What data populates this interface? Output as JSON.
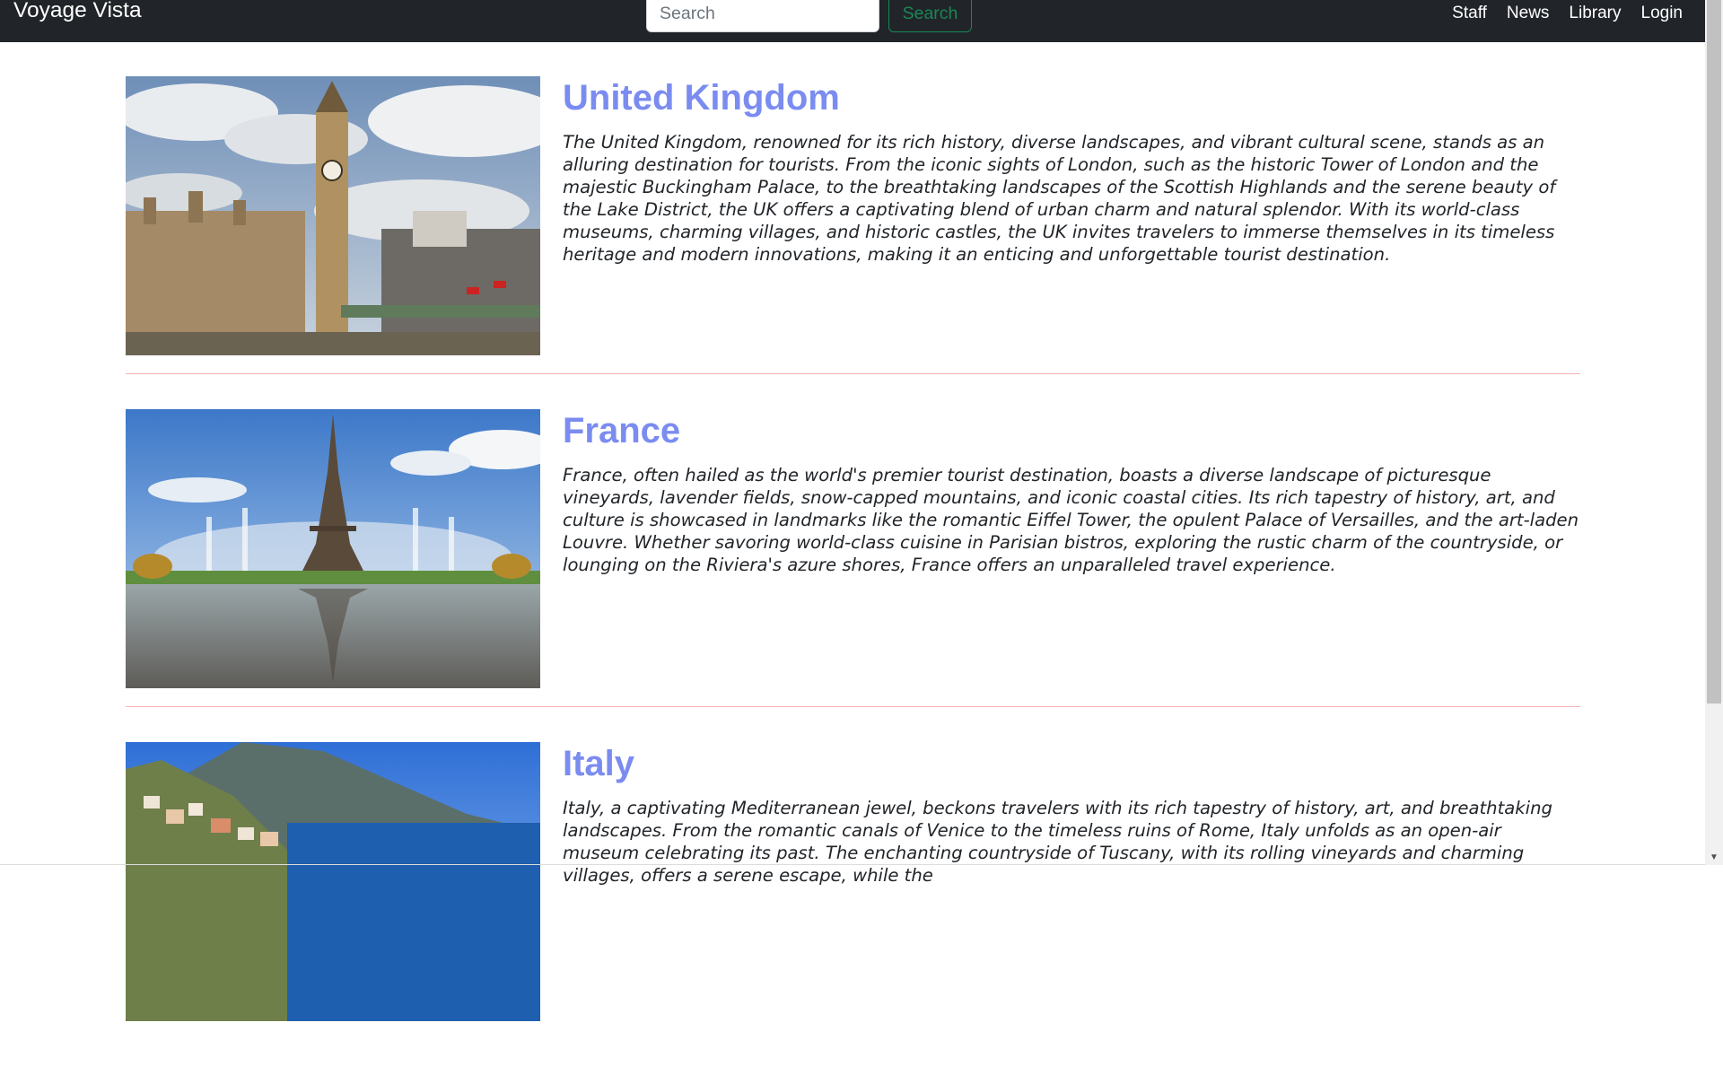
{
  "navbar": {
    "brand": "Voyage Vista",
    "search": {
      "placeholder": "Search",
      "value": "",
      "button_label": "Search"
    },
    "links": [
      "Staff",
      "News",
      "Library",
      "Login"
    ]
  },
  "countries": [
    {
      "title": "United Kingdom",
      "description": "The United Kingdom, renowned for its rich history, diverse landscapes, and vibrant cultural scene, stands as an alluring destination for tourists. From the iconic sights of London, such as the historic Tower of London and the majestic Buckingham Palace, to the breathtaking landscapes of the Scottish Highlands and the serene beauty of the Lake District, the UK offers a captivating blend of urban charm and natural splendor. With its world-class museums, charming villages, and historic castles, the UK invites travelers to immerse themselves in its timeless heritage and modern innovations, making it an enticing and unforgettable tourist destination."
    },
    {
      "title": "France",
      "description": "France, often hailed as the world's premier tourist destination, boasts a diverse landscape of picturesque vineyards, lavender fields, snow-capped mountains, and iconic coastal cities. Its rich tapestry of history, art, and culture is showcased in landmarks like the romantic Eiffel Tower, the opulent Palace of Versailles, and the art-laden Louvre. Whether savoring world-class cuisine in Parisian bistros, exploring the rustic charm of the countryside, or lounging on the Riviera's azure shores, France offers an unparalleled travel experience."
    },
    {
      "title": "Italy",
      "description": "Italy, a captivating Mediterranean jewel, beckons travelers with its rich tapestry of history, art, and breathtaking landscapes. From the romantic canals of Venice to the timeless ruins of Rome, Italy unfolds as an open-air museum celebrating its past. The enchanting countryside of Tuscany, with its rolling vineyards and charming villages, offers a serene escape, while the"
    }
  ],
  "colors": {
    "navbar_bg": "#212529",
    "title_accent": "#7b8cf0",
    "search_button": "#198754",
    "divider": "#f5b3b3"
  }
}
